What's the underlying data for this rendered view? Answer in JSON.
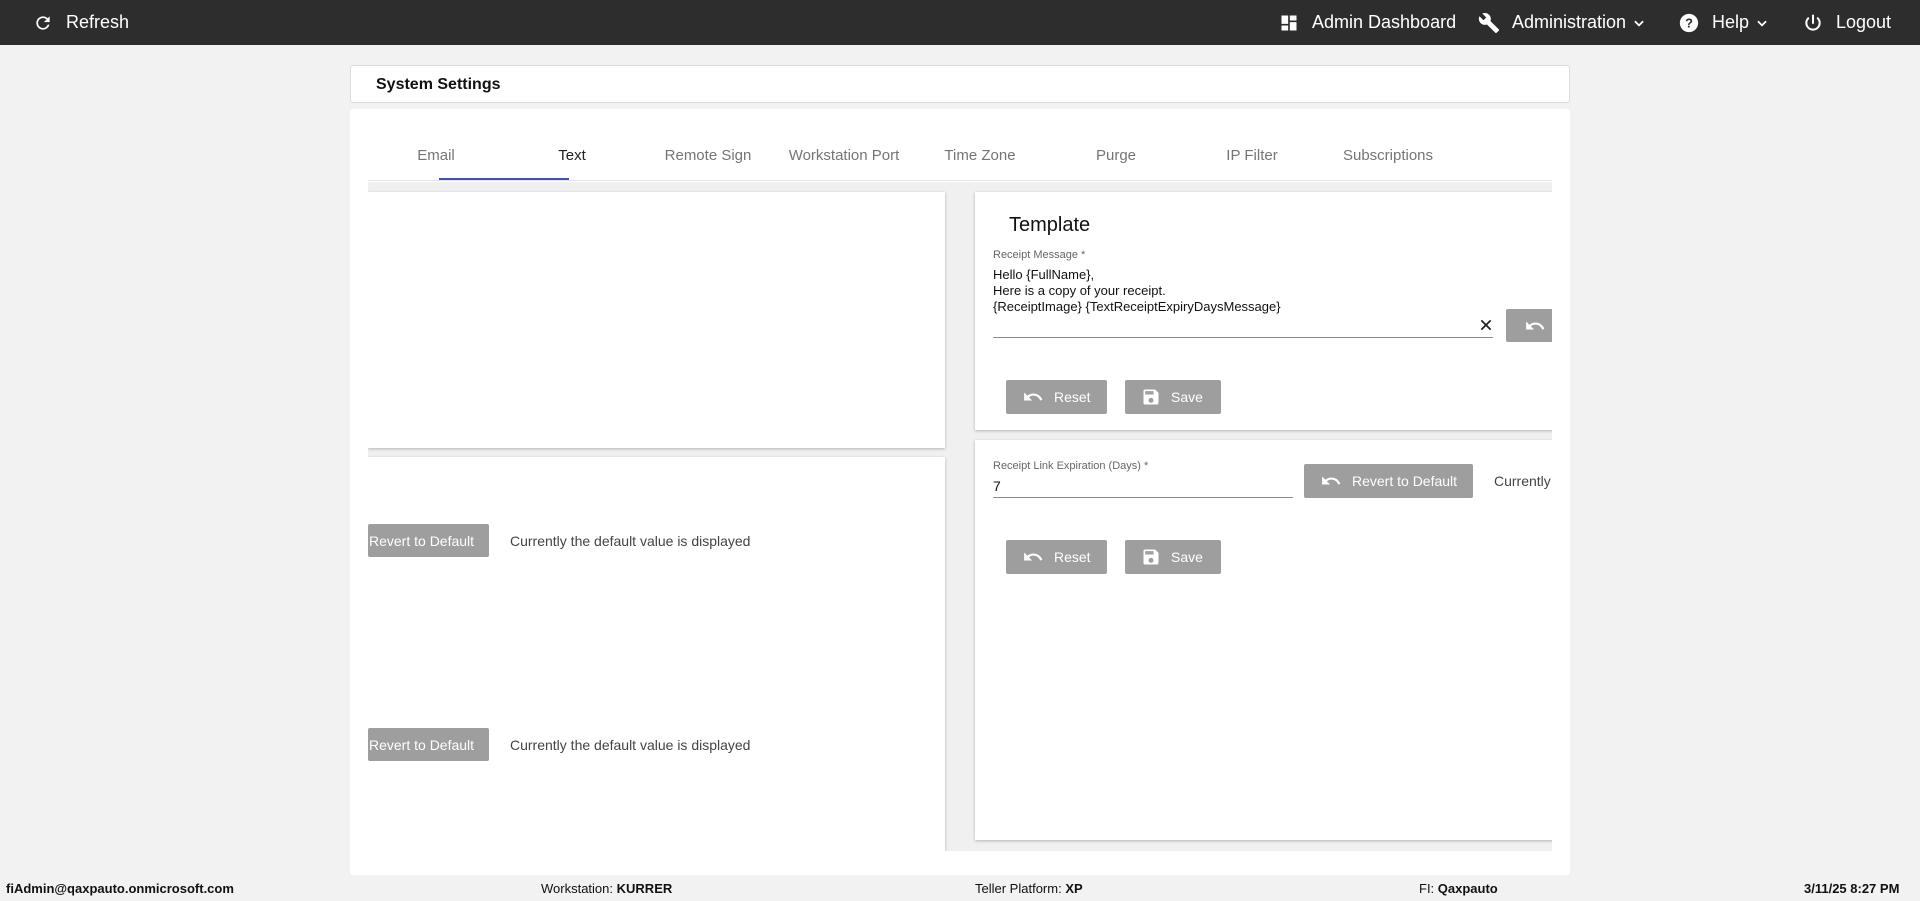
{
  "topbar": {
    "refresh_label": "Refresh",
    "admin_dashboard_label": "Admin Dashboard",
    "administration_label": "Administration",
    "help_label": "Help",
    "logout_label": "Logout",
    "background_color": "#2d2d2d"
  },
  "header": {
    "title": "System Settings"
  },
  "tabs": [
    {
      "label": "Email"
    },
    {
      "label": "Text",
      "active": true
    },
    {
      "label": "Remote Sign"
    },
    {
      "label": "Workstation Port"
    },
    {
      "label": "Time Zone"
    },
    {
      "label": "Purge"
    },
    {
      "label": "IP Filter"
    },
    {
      "label": "Subscriptions"
    }
  ],
  "tab_ink_color": "#3f51b5",
  "left_panel": {
    "row1": {
      "revert_label": "Revert to Default",
      "note": "Currently the default value is displayed"
    },
    "row2": {
      "revert_label": "Revert to Default",
      "note": "Currently the default value is displayed"
    }
  },
  "template_panel": {
    "title": "Template",
    "receipt_message": {
      "label": "Receipt Message *",
      "value": "Hello {FullName},\nHere is a copy of your receipt.\n{ReceiptImage} {TextReceiptExpiryDaysMessage}"
    },
    "reset_label": "Reset",
    "save_label": "Save"
  },
  "expiration_panel": {
    "field": {
      "label": "Receipt Link Expiration (Days) *",
      "value": "7"
    },
    "revert_label": "Revert to Default",
    "note": "Currently",
    "reset_label": "Reset",
    "save_label": "Save"
  },
  "statusbar": {
    "user": "fiAdmin@qaxpauto.onmicrosoft.com",
    "workstation_label": "Workstation:",
    "workstation_value": "KURRER",
    "teller_label": "Teller Platform:",
    "teller_value": "XP",
    "fi_label": "FI:",
    "fi_value": "Qaxpauto",
    "datetime": "3/11/25 8:27 PM"
  },
  "button_color": "#9e9e9e"
}
